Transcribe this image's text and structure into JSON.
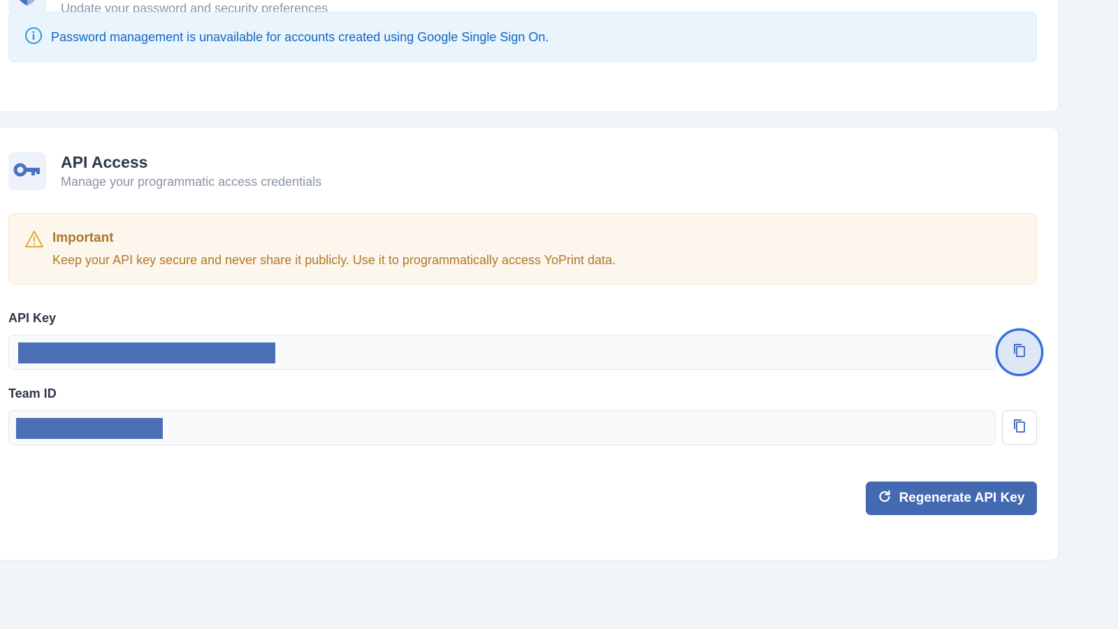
{
  "password_section": {
    "subtitle": "Update your password and security preferences",
    "info_banner": "Password management is unavailable for accounts created using Google Single Sign On.",
    "icon": "shield-icon"
  },
  "api_section": {
    "title": "API Access",
    "subtitle": "Manage your programmatic access credentials",
    "icon": "key-icon",
    "warning": {
      "title": "Important",
      "text": "Keep your API key secure and never share it publicly. Use it to programmatically access YoPrint data.",
      "icon": "warning-triangle-icon"
    },
    "fields": {
      "api_key_label": "API Key",
      "team_id_label": "Team ID"
    },
    "regenerate_label": "Regenerate API Key",
    "regenerate_icon": "refresh-icon"
  },
  "colors": {
    "accent": "#4369b0",
    "info_text": "#1367c0",
    "warning_text": "#b0782a",
    "redaction": "#4a6fb5"
  }
}
